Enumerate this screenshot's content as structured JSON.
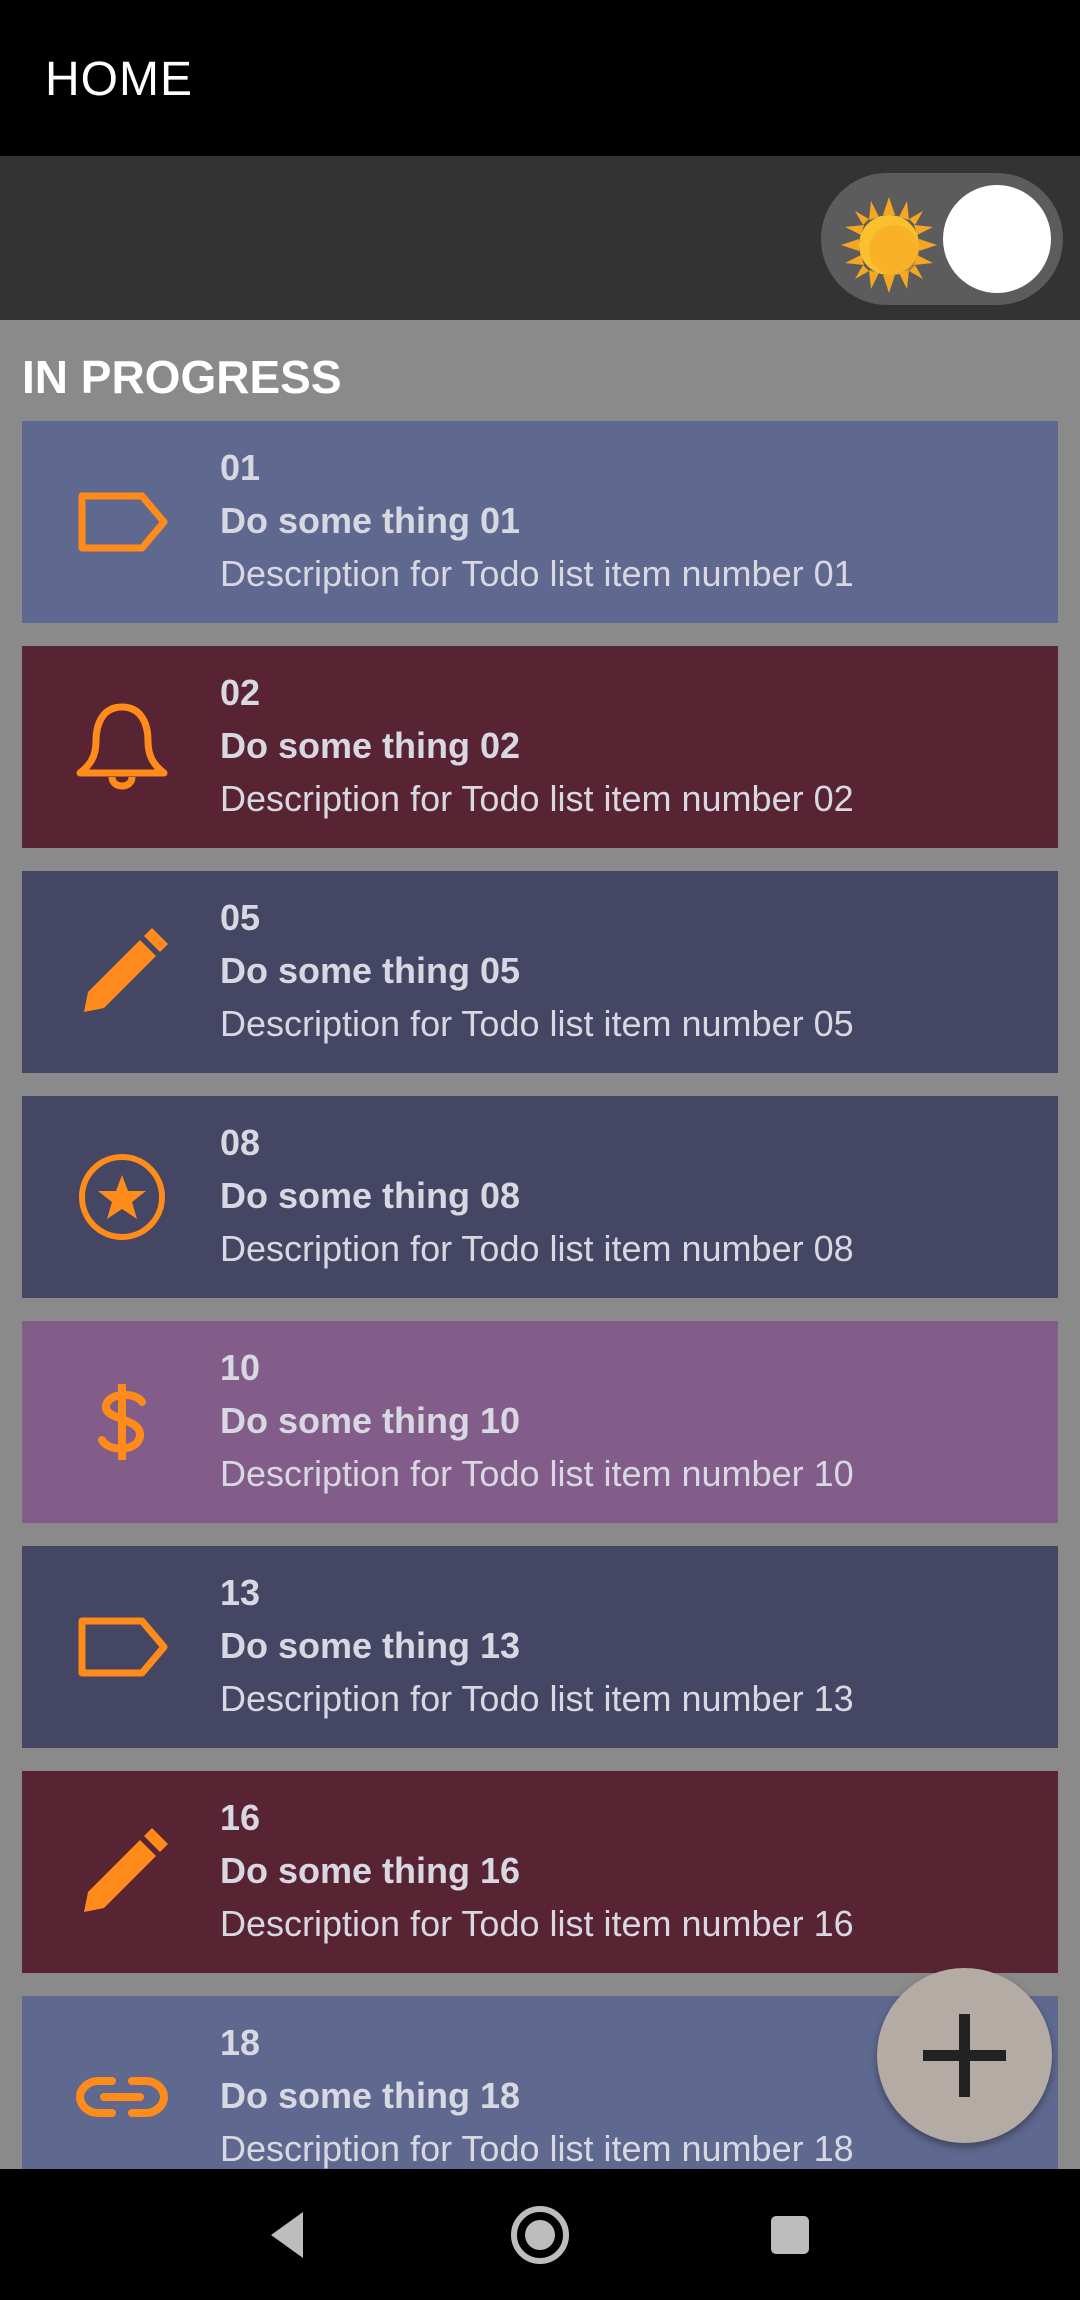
{
  "appbar": {
    "title": "HOME"
  },
  "section": {
    "title": "IN PROGRESS"
  },
  "colors": {
    "accent": "#ff8c1a",
    "text": "#d8d8e2"
  },
  "todos": [
    {
      "number": "01",
      "title": "Do some thing 01",
      "description": "Description for Todo list item number 01",
      "icon": "label-icon",
      "color": "#5f698f"
    },
    {
      "number": "02",
      "title": "Do some thing 02",
      "description": "Description for Todo list item number 02",
      "icon": "bell-icon",
      "color": "#582433"
    },
    {
      "number": "05",
      "title": "Do some thing 05",
      "description": "Description for Todo list item number 05",
      "icon": "pencil-icon",
      "color": "#454663"
    },
    {
      "number": "08",
      "title": "Do some thing 08",
      "description": "Description for Todo list item number 08",
      "icon": "star-circle-icon",
      "color": "#454663"
    },
    {
      "number": "10",
      "title": "Do some thing 10",
      "description": "Description for Todo list item number 10",
      "icon": "dollar-icon",
      "color": "#825d8a"
    },
    {
      "number": "13",
      "title": "Do some thing 13",
      "description": "Description for Todo list item number 13",
      "icon": "label-icon",
      "color": "#454663"
    },
    {
      "number": "16",
      "title": "Do some thing 16",
      "description": "Description for Todo list item number 16",
      "icon": "pencil-icon",
      "color": "#582433"
    },
    {
      "number": "18",
      "title": "Do some thing 18",
      "description": "Description for Todo list item number 18",
      "icon": "link-icon",
      "color": "#5f698f"
    }
  ]
}
